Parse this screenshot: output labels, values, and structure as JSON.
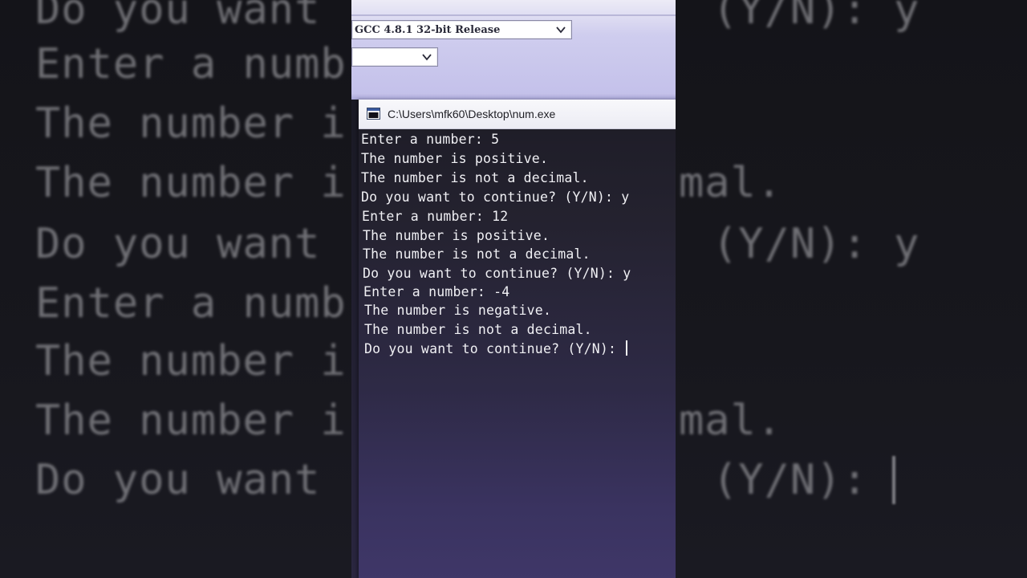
{
  "background": {
    "lines": [
      "Do you want",
      "Enter a numb",
      "The number i",
      "The number i",
      "Do you want",
      "Enter a numb",
      "The number i",
      "The number i",
      "Do you want"
    ],
    "right_lines": [
      "(Y/N): y",
      "mal.",
      "(Y/N): y",
      "mal.",
      "(Y/N):"
    ]
  },
  "ide": {
    "compiler_select": "GCC 4.8.1 32-bit Release",
    "target_select": ""
  },
  "console": {
    "title": "C:\\Users\\mfk60\\Desktop\\num.exe",
    "lines": [
      "Enter a number: 5",
      "The number is positive.",
      "The number is not a decimal.",
      "Do you want to continue? (Y/N): y",
      "Enter a number: 12",
      "The number is positive.",
      "The number is not a decimal.",
      "Do you want to continue? (Y/N): y",
      "Enter a number: -4",
      "The number is negative.",
      "The number is not a decimal.",
      "Do you want to continue? (Y/N): "
    ]
  },
  "colors": {
    "console_text": "#f0f0f4",
    "ide_toolbar": "#c3c0ea",
    "title_bar": "#f8f8fb"
  },
  "icons": {
    "console_window": "console-window-icon",
    "dropdown": "chevron-down-icon"
  }
}
